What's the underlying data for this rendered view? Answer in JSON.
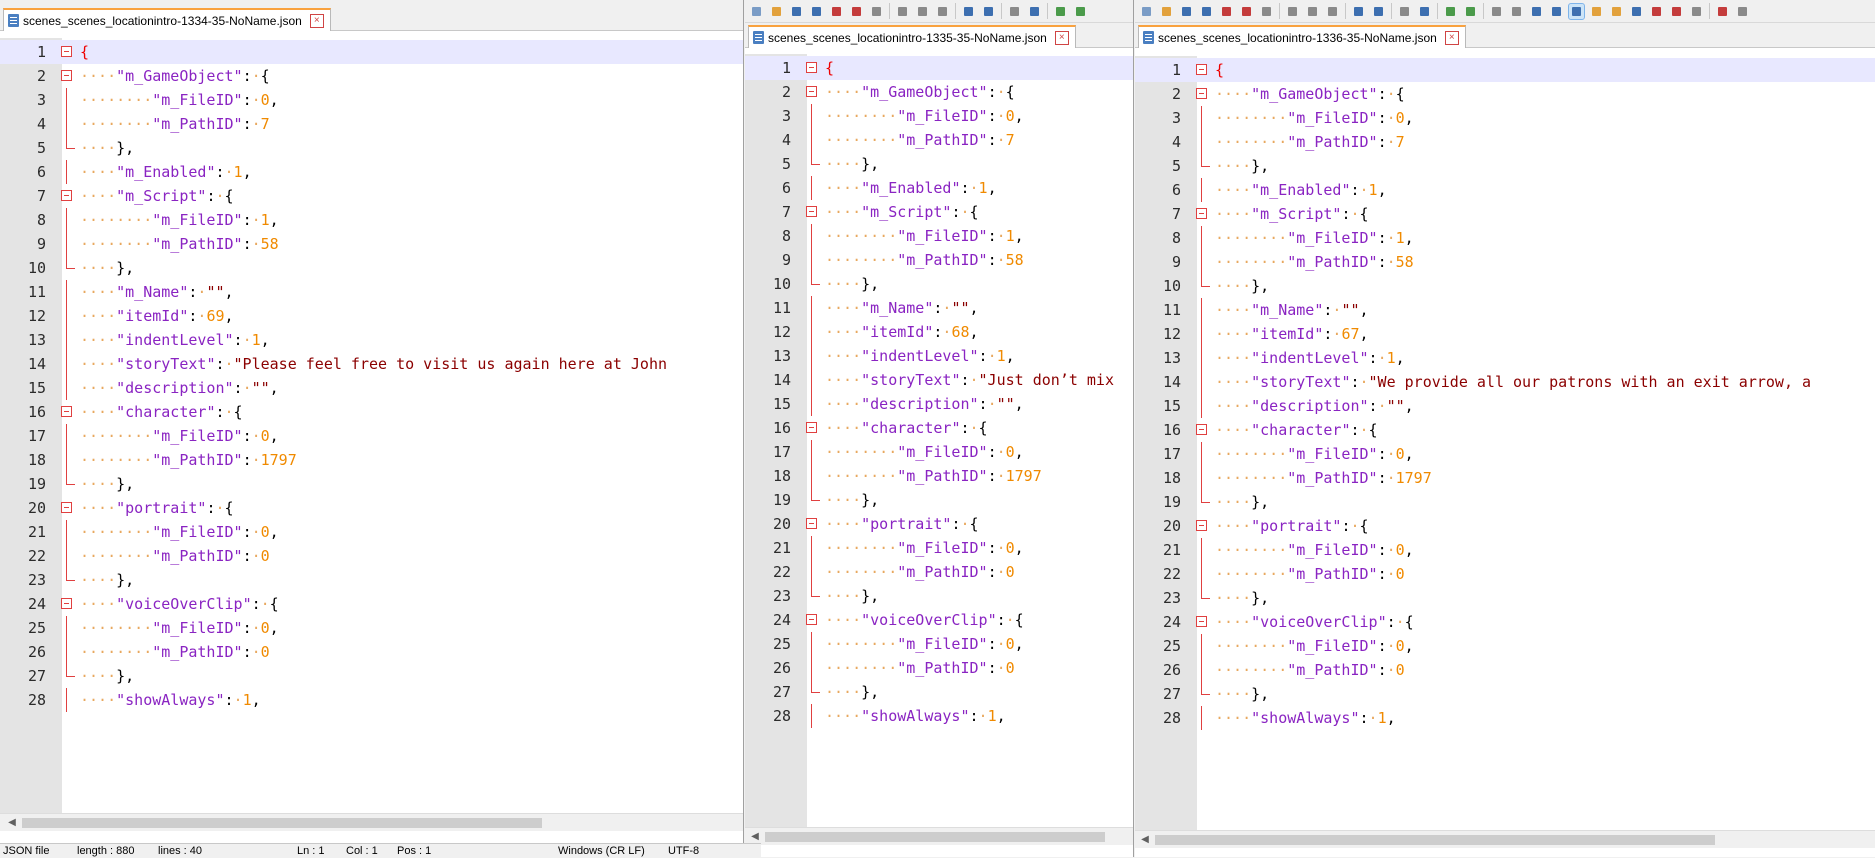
{
  "status": {
    "file_type": "JSON file",
    "length": "length : 880",
    "lines": "lines : 40",
    "ln": "Ln : 1",
    "col": "Col : 1",
    "pos": "Pos : 1",
    "eol": "Windows (CR LF)",
    "encoding": "UTF-8"
  },
  "panes": [
    {
      "tab": "scenes_scenes_locationintro-1334-35-NoName.json",
      "lines": [
        {
          "n": "1",
          "i": 0,
          "k": "",
          "v": "",
          "t": "open",
          "f": "m"
        },
        {
          "n": "2",
          "i": 1,
          "k": "m_GameObject",
          "v": "",
          "t": "obj",
          "f": "m"
        },
        {
          "n": "3",
          "i": 2,
          "k": "m_FileID",
          "v": "0",
          "t": "num",
          "c": ","
        },
        {
          "n": "4",
          "i": 2,
          "k": "m_PathID",
          "v": "7",
          "t": "num"
        },
        {
          "n": "5",
          "i": 1,
          "k": "",
          "v": "},",
          "t": "close",
          "f": "e"
        },
        {
          "n": "6",
          "i": 1,
          "k": "m_Enabled",
          "v": "1",
          "t": "num",
          "c": ","
        },
        {
          "n": "7",
          "i": 1,
          "k": "m_Script",
          "v": "",
          "t": "obj",
          "f": "m"
        },
        {
          "n": "8",
          "i": 2,
          "k": "m_FileID",
          "v": "1",
          "t": "num",
          "c": ","
        },
        {
          "n": "9",
          "i": 2,
          "k": "m_PathID",
          "v": "58",
          "t": "num"
        },
        {
          "n": "10",
          "i": 1,
          "k": "",
          "v": "},",
          "t": "close",
          "f": "e"
        },
        {
          "n": "11",
          "i": 1,
          "k": "m_Name",
          "v": "\"\"",
          "t": "str",
          "c": ","
        },
        {
          "n": "12",
          "i": 1,
          "k": "itemId",
          "v": "69",
          "t": "num",
          "c": ","
        },
        {
          "n": "13",
          "i": 1,
          "k": "indentLevel",
          "v": "1",
          "t": "num",
          "c": ","
        },
        {
          "n": "14",
          "i": 1,
          "k": "storyText",
          "v": "\"Please feel free to visit us again here at John",
          "t": "str"
        },
        {
          "n": "15",
          "i": 1,
          "k": "description",
          "v": "\"\"",
          "t": "str",
          "c": ","
        },
        {
          "n": "16",
          "i": 1,
          "k": "character",
          "v": "",
          "t": "obj",
          "f": "m"
        },
        {
          "n": "17",
          "i": 2,
          "k": "m_FileID",
          "v": "0",
          "t": "num",
          "c": ","
        },
        {
          "n": "18",
          "i": 2,
          "k": "m_PathID",
          "v": "1797",
          "t": "num"
        },
        {
          "n": "19",
          "i": 1,
          "k": "",
          "v": "},",
          "t": "close",
          "f": "e"
        },
        {
          "n": "20",
          "i": 1,
          "k": "portrait",
          "v": "",
          "t": "obj",
          "f": "m"
        },
        {
          "n": "21",
          "i": 2,
          "k": "m_FileID",
          "v": "0",
          "t": "num",
          "c": ","
        },
        {
          "n": "22",
          "i": 2,
          "k": "m_PathID",
          "v": "0",
          "t": "num"
        },
        {
          "n": "23",
          "i": 1,
          "k": "",
          "v": "},",
          "t": "close",
          "f": "e"
        },
        {
          "n": "24",
          "i": 1,
          "k": "voiceOverClip",
          "v": "",
          "t": "obj",
          "f": "m"
        },
        {
          "n": "25",
          "i": 2,
          "k": "m_FileID",
          "v": "0",
          "t": "num",
          "c": ","
        },
        {
          "n": "26",
          "i": 2,
          "k": "m_PathID",
          "v": "0",
          "t": "num"
        },
        {
          "n": "27",
          "i": 1,
          "k": "",
          "v": "},",
          "t": "close",
          "f": "e"
        },
        {
          "n": "28",
          "i": 1,
          "k": "showAlways",
          "v": "1",
          "t": "num",
          "c": ","
        }
      ]
    },
    {
      "tab": "scenes_scenes_locationintro-1335-35-NoName.json",
      "lines": [
        {
          "n": "1",
          "i": 0,
          "k": "",
          "v": "",
          "t": "open",
          "f": "m"
        },
        {
          "n": "2",
          "i": 1,
          "k": "m_GameObject",
          "v": "",
          "t": "obj",
          "f": "m"
        },
        {
          "n": "3",
          "i": 2,
          "k": "m_FileID",
          "v": "0",
          "t": "num",
          "c": ","
        },
        {
          "n": "4",
          "i": 2,
          "k": "m_PathID",
          "v": "7",
          "t": "num"
        },
        {
          "n": "5",
          "i": 1,
          "k": "",
          "v": "},",
          "t": "close",
          "f": "e"
        },
        {
          "n": "6",
          "i": 1,
          "k": "m_Enabled",
          "v": "1",
          "t": "num",
          "c": ","
        },
        {
          "n": "7",
          "i": 1,
          "k": "m_Script",
          "v": "",
          "t": "obj",
          "f": "m"
        },
        {
          "n": "8",
          "i": 2,
          "k": "m_FileID",
          "v": "1",
          "t": "num",
          "c": ","
        },
        {
          "n": "9",
          "i": 2,
          "k": "m_PathID",
          "v": "58",
          "t": "num"
        },
        {
          "n": "10",
          "i": 1,
          "k": "",
          "v": "},",
          "t": "close",
          "f": "e"
        },
        {
          "n": "11",
          "i": 1,
          "k": "m_Name",
          "v": "\"\"",
          "t": "str",
          "c": ","
        },
        {
          "n": "12",
          "i": 1,
          "k": "itemId",
          "v": "68",
          "t": "num",
          "c": ","
        },
        {
          "n": "13",
          "i": 1,
          "k": "indentLevel",
          "v": "1",
          "t": "num",
          "c": ","
        },
        {
          "n": "14",
          "i": 1,
          "k": "storyText",
          "v": "\"Just don’t mix",
          "t": "str"
        },
        {
          "n": "15",
          "i": 1,
          "k": "description",
          "v": "\"\"",
          "t": "str",
          "c": ","
        },
        {
          "n": "16",
          "i": 1,
          "k": "character",
          "v": "",
          "t": "obj",
          "f": "m"
        },
        {
          "n": "17",
          "i": 2,
          "k": "m_FileID",
          "v": "0",
          "t": "num",
          "c": ","
        },
        {
          "n": "18",
          "i": 2,
          "k": "m_PathID",
          "v": "1797",
          "t": "num"
        },
        {
          "n": "19",
          "i": 1,
          "k": "",
          "v": "},",
          "t": "close",
          "f": "e"
        },
        {
          "n": "20",
          "i": 1,
          "k": "portrait",
          "v": "",
          "t": "obj",
          "f": "m"
        },
        {
          "n": "21",
          "i": 2,
          "k": "m_FileID",
          "v": "0",
          "t": "num",
          "c": ","
        },
        {
          "n": "22",
          "i": 2,
          "k": "m_PathID",
          "v": "0",
          "t": "num"
        },
        {
          "n": "23",
          "i": 1,
          "k": "",
          "v": "},",
          "t": "close",
          "f": "e"
        },
        {
          "n": "24",
          "i": 1,
          "k": "voiceOverClip",
          "v": "",
          "t": "obj",
          "f": "m"
        },
        {
          "n": "25",
          "i": 2,
          "k": "m_FileID",
          "v": "0",
          "t": "num",
          "c": ","
        },
        {
          "n": "26",
          "i": 2,
          "k": "m_PathID",
          "v": "0",
          "t": "num"
        },
        {
          "n": "27",
          "i": 1,
          "k": "",
          "v": "},",
          "t": "close",
          "f": "e"
        },
        {
          "n": "28",
          "i": 1,
          "k": "showAlways",
          "v": "1",
          "t": "num",
          "c": ","
        }
      ]
    },
    {
      "tab": "scenes_scenes_locationintro-1336-35-NoName.json",
      "lines": [
        {
          "n": "1",
          "i": 0,
          "k": "",
          "v": "",
          "t": "open",
          "f": "m"
        },
        {
          "n": "2",
          "i": 1,
          "k": "m_GameObject",
          "v": "",
          "t": "obj",
          "f": "m"
        },
        {
          "n": "3",
          "i": 2,
          "k": "m_FileID",
          "v": "0",
          "t": "num",
          "c": ","
        },
        {
          "n": "4",
          "i": 2,
          "k": "m_PathID",
          "v": "7",
          "t": "num"
        },
        {
          "n": "5",
          "i": 1,
          "k": "",
          "v": "},",
          "t": "close",
          "f": "e"
        },
        {
          "n": "6",
          "i": 1,
          "k": "m_Enabled",
          "v": "1",
          "t": "num",
          "c": ","
        },
        {
          "n": "7",
          "i": 1,
          "k": "m_Script",
          "v": "",
          "t": "obj",
          "f": "m"
        },
        {
          "n": "8",
          "i": 2,
          "k": "m_FileID",
          "v": "1",
          "t": "num",
          "c": ","
        },
        {
          "n": "9",
          "i": 2,
          "k": "m_PathID",
          "v": "58",
          "t": "num"
        },
        {
          "n": "10",
          "i": 1,
          "k": "",
          "v": "},",
          "t": "close",
          "f": "e"
        },
        {
          "n": "11",
          "i": 1,
          "k": "m_Name",
          "v": "\"\"",
          "t": "str",
          "c": ","
        },
        {
          "n": "12",
          "i": 1,
          "k": "itemId",
          "v": "67",
          "t": "num",
          "c": ","
        },
        {
          "n": "13",
          "i": 1,
          "k": "indentLevel",
          "v": "1",
          "t": "num",
          "c": ","
        },
        {
          "n": "14",
          "i": 1,
          "k": "storyText",
          "v": "\"We provide all our patrons with an exit arrow, a",
          "t": "str"
        },
        {
          "n": "15",
          "i": 1,
          "k": "description",
          "v": "\"\"",
          "t": "str",
          "c": ","
        },
        {
          "n": "16",
          "i": 1,
          "k": "character",
          "v": "",
          "t": "obj",
          "f": "m"
        },
        {
          "n": "17",
          "i": 2,
          "k": "m_FileID",
          "v": "0",
          "t": "num",
          "c": ","
        },
        {
          "n": "18",
          "i": 2,
          "k": "m_PathID",
          "v": "1797",
          "t": "num"
        },
        {
          "n": "19",
          "i": 1,
          "k": "",
          "v": "},",
          "t": "close",
          "f": "e"
        },
        {
          "n": "20",
          "i": 1,
          "k": "portrait",
          "v": "",
          "t": "obj",
          "f": "m"
        },
        {
          "n": "21",
          "i": 2,
          "k": "m_FileID",
          "v": "0",
          "t": "num",
          "c": ","
        },
        {
          "n": "22",
          "i": 2,
          "k": "m_PathID",
          "v": "0",
          "t": "num"
        },
        {
          "n": "23",
          "i": 1,
          "k": "",
          "v": "},",
          "t": "close",
          "f": "e"
        },
        {
          "n": "24",
          "i": 1,
          "k": "voiceOverClip",
          "v": "",
          "t": "obj",
          "f": "m"
        },
        {
          "n": "25",
          "i": 2,
          "k": "m_FileID",
          "v": "0",
          "t": "num",
          "c": ","
        },
        {
          "n": "26",
          "i": 2,
          "k": "m_PathID",
          "v": "0",
          "t": "num"
        },
        {
          "n": "27",
          "i": 1,
          "k": "",
          "v": "},",
          "t": "close",
          "f": "e"
        },
        {
          "n": "28",
          "i": 1,
          "k": "showAlways",
          "v": "1",
          "t": "num",
          "c": ","
        }
      ]
    }
  ]
}
